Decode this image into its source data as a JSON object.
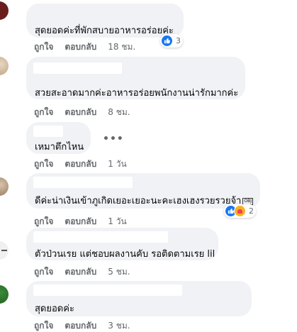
{
  "comments": [
    {
      "text": "สุดยอดค่ะที่พักสบายอาหารอร่อยค่ะ",
      "like": "ถูกใจ",
      "reply": "ตอบกลับ",
      "time": "18 ชม.",
      "reaction_count": "3"
    },
    {
      "text": "สวยสะอาดมากค่ะอาหารอร่อยพนักงานน่ารักมากค่ะ",
      "like": "ถูกใจ",
      "reply": "ตอบกลับ",
      "time": "8 ชม."
    },
    {
      "text": "เหมาตึกไหน",
      "like": "ถูกใจ",
      "reply": "ตอบกลับ",
      "time": "1 วัน",
      "more": "•••"
    },
    {
      "text": "ดีค่ะน่าเงินเข้าภูเกิดเยอะเยอะนะคะเฮงเฮงรวยรวยจ้า",
      "emoji_box": "OBJ",
      "like": "ถูกใจ",
      "reply": "ตอบกลับ",
      "time": "1 วัน",
      "reaction_count": "2"
    },
    {
      "text": "ตัวป่วนเรย แต่ชอบผลงานคับ รอติดตามเรย lil",
      "like": "ถูกใจ",
      "reply": "ตอบกลับ",
      "time": "5 ชม."
    },
    {
      "text": "สุดยอดค่ะ",
      "like": "ถูกใจ",
      "reply": "ตอบกลับ",
      "time": "3 ชม."
    }
  ],
  "colors": {
    "bubble": "#f0f2f5",
    "like_blue": "#1877f2",
    "meta_gray": "#65676b"
  },
  "icons": {
    "like": "thumbs-up-icon",
    "care": "care-hug-icon",
    "more": "more-horizontal-icon"
  }
}
